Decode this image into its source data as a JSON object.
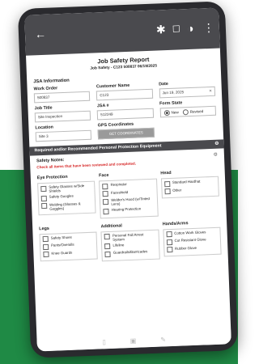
{
  "colors": {
    "green_bg": "#1f8a45",
    "dark": "#4a4a4e",
    "red": "#d62828"
  },
  "appbar": {
    "back_icon": "←",
    "icons": [
      "✱",
      "☐",
      "◑",
      "⋮"
    ]
  },
  "report": {
    "title": "Job Safety Report",
    "subtitle": "Job Safety - C123 500837 06/19/2025"
  },
  "jsa_information": {
    "header": "JSA Information",
    "work_order_label": "Work Order",
    "work_order_value": "500837",
    "customer_name_label": "Customer Name",
    "customer_name_value": "C123",
    "date_label": "Date",
    "date_value": "Jun 19, 2025",
    "job_title_label": "Job Title",
    "job_title_value": "Site Inspection",
    "jsa_no_label": "JSA #",
    "jsa_no_value": "512249",
    "form_state_label": "Form State",
    "form_state_new": "New",
    "form_state_revised": "Revised",
    "location_label": "Location",
    "location_value": "Site 3",
    "gps_label": "GPS Coordinates",
    "gps_button": "GET COORDINATES"
  },
  "ppe": {
    "header": "Required and/or Recommended Personal Protection Equipment",
    "notes_label": "Safety Notes:",
    "red_note": "Check all items that have been reviewed and completed.",
    "eye_protection": {
      "title": "Eye Protection",
      "items": [
        "Safety Glasses w/Side Shields",
        "Safety Googles",
        "Welding (Glasses & Goggles)"
      ]
    },
    "face": {
      "title": "Face",
      "items": [
        "Respirator",
        "Faceshield",
        "Welder's Hood (w/Tinted Lens)",
        "Hearing Protection"
      ]
    },
    "head": {
      "title": "Head",
      "items": [
        "Standard Hardhat",
        "Other"
      ]
    },
    "legs": {
      "title": "Legs",
      "items": [
        "Safety Shoes",
        "Pants/Overalls",
        "Knee Guards"
      ]
    },
    "additional": {
      "title": "Additional",
      "items": [
        "Personal Fall Arrest System",
        "Lifeline",
        "Guardrails/Barricades"
      ]
    },
    "hands": {
      "title": "Hands/Arms",
      "items": [
        "Cotton Work Gloves",
        "Cut Resistant Glove",
        "Rubber Glove"
      ]
    }
  }
}
